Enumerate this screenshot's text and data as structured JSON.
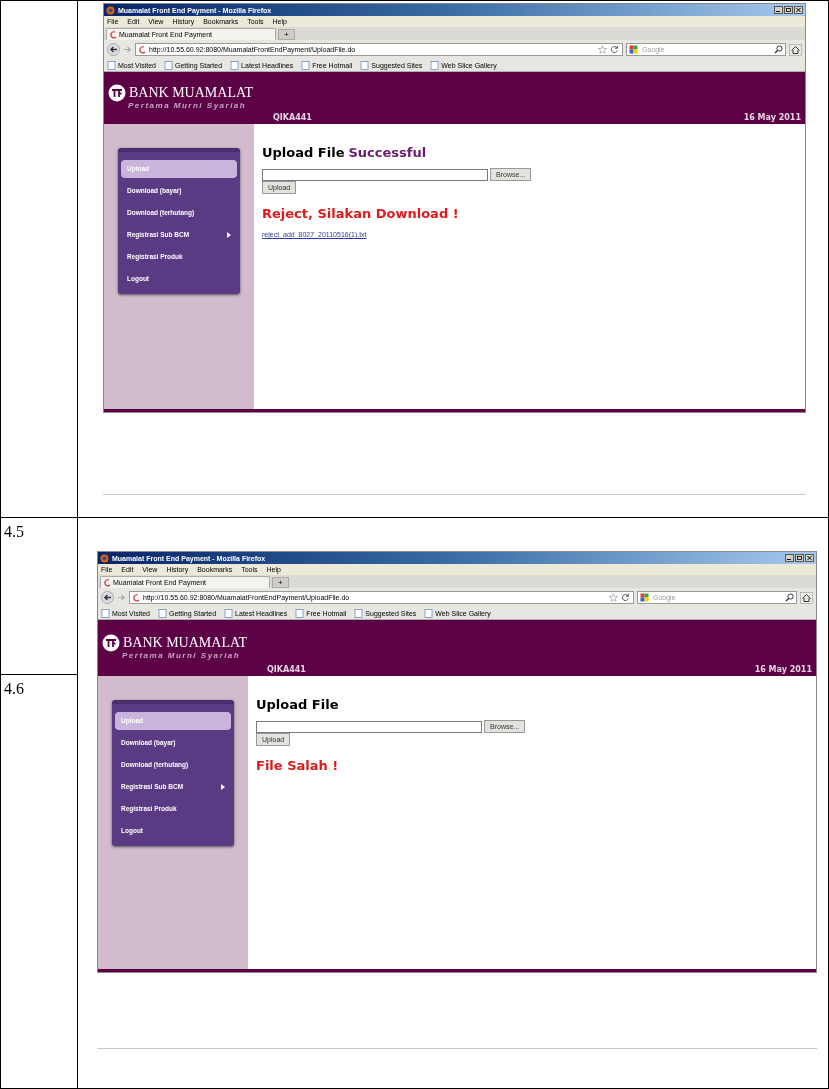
{
  "rows": [
    {
      "screenshot": {
        "window_title": "Muamalat Front End Payment - Mozilla Firefox",
        "menu": [
          "File",
          "Edit",
          "View",
          "History",
          "Bookmarks",
          "Tools",
          "Help"
        ],
        "tab_title": "Muamalat Front End Payment",
        "new_tab": "+",
        "url": "http://10.55.60.92:8080/MuamalatFrontEndPayment/UploadFile.do",
        "search_placeholder": "Google",
        "bookmarks": [
          "Most Visited",
          "Getting Started",
          "Latest Headlines",
          "Free Hotmail",
          "Suggested Sites",
          "Web Slice Gallery"
        ],
        "bank_name": "BANK MUAMALAT",
        "tagline": "Pertama Murni Syariah",
        "user": "QIKA441",
        "date": "16 May 2011",
        "sidebar": [
          {
            "label": "Upload",
            "selected": true,
            "submenu": false
          },
          {
            "label": "Download (bayar)",
            "selected": false,
            "submenu": false
          },
          {
            "label": "Download (terhutang)",
            "selected": false,
            "submenu": false
          },
          {
            "label": "Registrasi Sub BCM",
            "selected": false,
            "submenu": true
          },
          {
            "label": "Registrasi Produk",
            "selected": false,
            "submenu": false
          },
          {
            "label": "Logout",
            "selected": false,
            "submenu": false
          }
        ],
        "heading": "Upload File",
        "heading_status": "Successful",
        "browse_button": "Browse...",
        "upload_button": "Upload",
        "message": "Reject, Silakan Download !",
        "link": "reject_add_8027_20110516(1).txt"
      }
    },
    {
      "labels": [
        "4.5",
        "4.6"
      ],
      "screenshot": {
        "window_title": "Muamalat Front End Payment - Mozilla Firefox",
        "menu": [
          "File",
          "Edit",
          "View",
          "History",
          "Bookmarks",
          "Tools",
          "Help"
        ],
        "tab_title": "Muamalat Front End Payment",
        "new_tab": "+",
        "url": "http://10.55.60.92:8080/MuamalatFrontEndPayment/UploadFile.do",
        "search_placeholder": "Google",
        "bookmarks": [
          "Most Visited",
          "Getting Started",
          "Latest Headlines",
          "Free Hotmail",
          "Suggested Sites",
          "Web Slice Gallery"
        ],
        "bank_name": "BANK MUAMALAT",
        "tagline": "Pertama Murni Syariah",
        "user": "QIKA441",
        "date": "16 May 2011",
        "sidebar": [
          {
            "label": "Upload",
            "selected": true,
            "submenu": false
          },
          {
            "label": "Download (bayar)",
            "selected": false,
            "submenu": false
          },
          {
            "label": "Download (terhutang)",
            "selected": false,
            "submenu": false
          },
          {
            "label": "Registrasi Sub BCM",
            "selected": false,
            "submenu": true
          },
          {
            "label": "Registrasi Produk",
            "selected": false,
            "submenu": false
          },
          {
            "label": "Logout",
            "selected": false,
            "submenu": false
          }
        ],
        "heading": "Upload File",
        "browse_button": "Browse...",
        "upload_button": "Upload",
        "message": "File Salah !"
      }
    }
  ]
}
